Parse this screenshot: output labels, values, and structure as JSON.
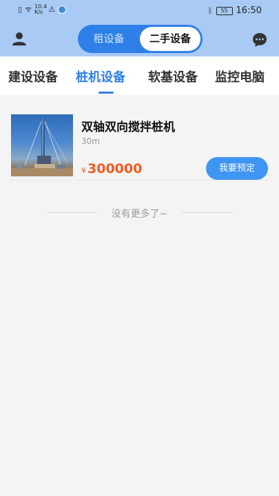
{
  "status_bar": {
    "net_speed_value": "10.4",
    "net_speed_unit": "K/s",
    "battery": "55",
    "time": "16:50"
  },
  "header": {
    "segment_rent": "租设备",
    "segment_used": "二手设备",
    "active_segment": "二手设备"
  },
  "tabs": [
    {
      "label": "建设设备",
      "active": false
    },
    {
      "label": "桩机设备",
      "active": true
    },
    {
      "label": "软基设备",
      "active": false
    },
    {
      "label": "监控电脑",
      "active": false
    }
  ],
  "products": [
    {
      "title": "双轴双向搅拌桩机",
      "spec": "30m",
      "currency": "¥",
      "price": "300000",
      "button": "我要预定"
    }
  ],
  "list_end_text": "没有更多了~",
  "colors": {
    "header_bg": "#a9caf4",
    "accent": "#2f7fe8",
    "price": "#f25a1e",
    "button": "#3f95f3"
  },
  "icons": [
    "user-icon",
    "chat-icon",
    "bluetooth-icon",
    "wifi-icon",
    "battery-icon"
  ]
}
